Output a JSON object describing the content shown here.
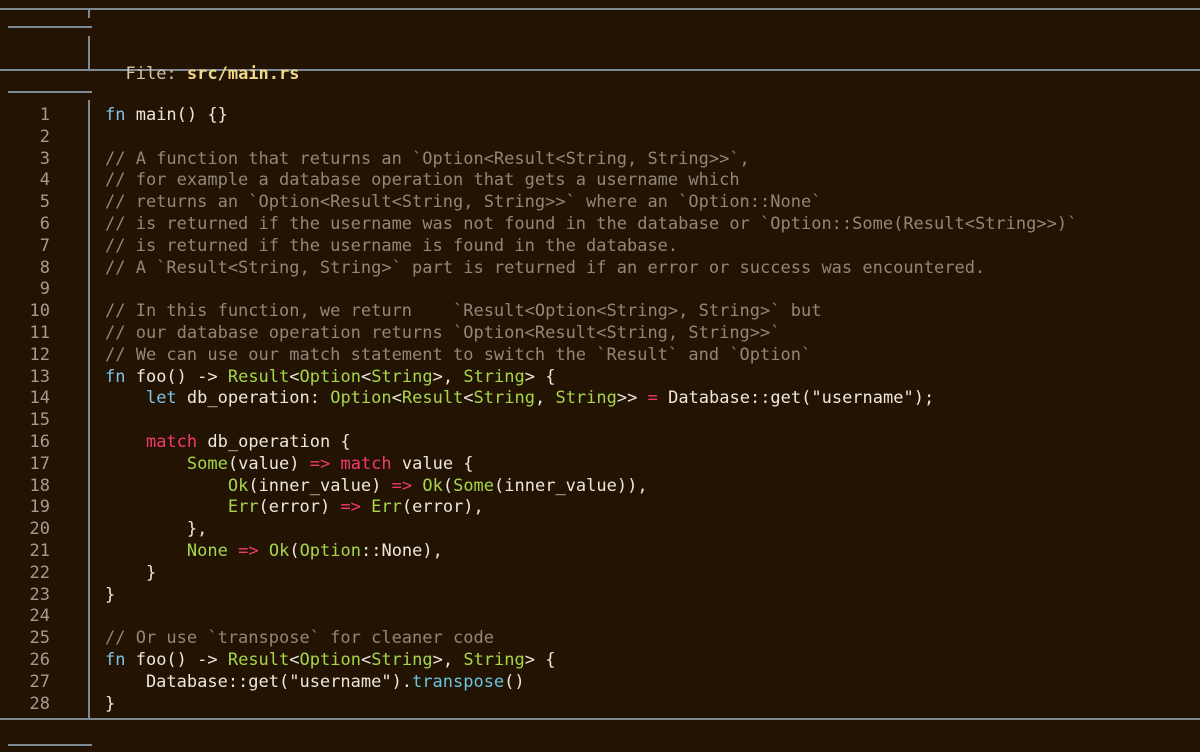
{
  "colors": {
    "background": "#231303",
    "rule": "#7d8a93",
    "keyword": "#7fc3e8",
    "type": "#a6d64a",
    "control": "#f23a6e",
    "comment": "#918779",
    "text": "#ece7dc",
    "line_number": "#a59b8e",
    "file_name": "#f0d68a"
  },
  "header": {
    "label": "File: ",
    "filename": "src/main.rs"
  },
  "code": {
    "lines": [
      [
        {
          "t": "fn",
          "c": "kw"
        },
        {
          "t": " main() {}",
          "c": "plain"
        }
      ],
      [],
      [
        {
          "t": "// A function that returns an `Option<Result<String, String>>`,",
          "c": "comment"
        }
      ],
      [
        {
          "t": "// for example a database operation that gets a username which",
          "c": "comment"
        }
      ],
      [
        {
          "t": "// returns an `Option<Result<String, String>>` where an `Option::None`",
          "c": "comment"
        }
      ],
      [
        {
          "t": "// is returned if the username was not found in the database or `Option::Some(Result<String>>)`",
          "c": "comment"
        }
      ],
      [
        {
          "t": "// is returned if the username is found in the database.",
          "c": "comment"
        }
      ],
      [
        {
          "t": "// A `Result<String, String>` part is returned if an error or success was encountered.",
          "c": "comment"
        }
      ],
      [],
      [
        {
          "t": "// In this function, we return    `Result<Option<String>, String>` but",
          "c": "comment"
        }
      ],
      [
        {
          "t": "// our database operation returns `Option<Result<String, String>>`",
          "c": "comment"
        }
      ],
      [
        {
          "t": "// We can use our match statement to switch the `Result` and `Option`",
          "c": "comment"
        }
      ],
      [
        {
          "t": "fn",
          "c": "kw"
        },
        {
          "t": " foo() -> ",
          "c": "plain"
        },
        {
          "t": "Result",
          "c": "type"
        },
        {
          "t": "<",
          "c": "plain"
        },
        {
          "t": "Option",
          "c": "type"
        },
        {
          "t": "<",
          "c": "plain"
        },
        {
          "t": "String",
          "c": "type"
        },
        {
          "t": ">, ",
          "c": "plain"
        },
        {
          "t": "String",
          "c": "type"
        },
        {
          "t": "> {",
          "c": "plain"
        }
      ],
      [
        {
          "t": "    ",
          "c": "plain"
        },
        {
          "t": "let",
          "c": "kw"
        },
        {
          "t": " db_operation: ",
          "c": "plain"
        },
        {
          "t": "Option",
          "c": "type"
        },
        {
          "t": "<",
          "c": "plain"
        },
        {
          "t": "Result",
          "c": "type"
        },
        {
          "t": "<",
          "c": "plain"
        },
        {
          "t": "String",
          "c": "type"
        },
        {
          "t": ", ",
          "c": "plain"
        },
        {
          "t": "String",
          "c": "type"
        },
        {
          "t": ">> ",
          "c": "plain"
        },
        {
          "t": "=",
          "c": "ctrl"
        },
        {
          "t": " Database::get(\"username\");",
          "c": "plain"
        }
      ],
      [],
      [
        {
          "t": "    ",
          "c": "plain"
        },
        {
          "t": "match",
          "c": "ctrl"
        },
        {
          "t": " db_operation {",
          "c": "plain"
        }
      ],
      [
        {
          "t": "        ",
          "c": "plain"
        },
        {
          "t": "Some",
          "c": "type"
        },
        {
          "t": "(value) ",
          "c": "plain"
        },
        {
          "t": "=>",
          "c": "ctrl"
        },
        {
          "t": " ",
          "c": "plain"
        },
        {
          "t": "match",
          "c": "ctrl"
        },
        {
          "t": " value {",
          "c": "plain"
        }
      ],
      [
        {
          "t": "            ",
          "c": "plain"
        },
        {
          "t": "Ok",
          "c": "type"
        },
        {
          "t": "(inner_value) ",
          "c": "plain"
        },
        {
          "t": "=>",
          "c": "ctrl"
        },
        {
          "t": " ",
          "c": "plain"
        },
        {
          "t": "Ok",
          "c": "type"
        },
        {
          "t": "(",
          "c": "plain"
        },
        {
          "t": "Some",
          "c": "type"
        },
        {
          "t": "(inner_value)),",
          "c": "plain"
        }
      ],
      [
        {
          "t": "            ",
          "c": "plain"
        },
        {
          "t": "Err",
          "c": "type"
        },
        {
          "t": "(error) ",
          "c": "plain"
        },
        {
          "t": "=>",
          "c": "ctrl"
        },
        {
          "t": " ",
          "c": "plain"
        },
        {
          "t": "Err",
          "c": "type"
        },
        {
          "t": "(error),",
          "c": "plain"
        }
      ],
      [
        {
          "t": "        },",
          "c": "plain"
        }
      ],
      [
        {
          "t": "        ",
          "c": "plain"
        },
        {
          "t": "None",
          "c": "type"
        },
        {
          "t": " ",
          "c": "plain"
        },
        {
          "t": "=>",
          "c": "ctrl"
        },
        {
          "t": " ",
          "c": "plain"
        },
        {
          "t": "Ok",
          "c": "type"
        },
        {
          "t": "(",
          "c": "plain"
        },
        {
          "t": "Option",
          "c": "type"
        },
        {
          "t": "::None),",
          "c": "plain"
        }
      ],
      [
        {
          "t": "    }",
          "c": "plain"
        }
      ],
      [
        {
          "t": "}",
          "c": "plain"
        }
      ],
      [],
      [
        {
          "t": "// Or use `transpose` for cleaner code",
          "c": "comment"
        }
      ],
      [
        {
          "t": "fn",
          "c": "kw"
        },
        {
          "t": " foo() -> ",
          "c": "plain"
        },
        {
          "t": "Result",
          "c": "type"
        },
        {
          "t": "<",
          "c": "plain"
        },
        {
          "t": "Option",
          "c": "type"
        },
        {
          "t": "<",
          "c": "plain"
        },
        {
          "t": "String",
          "c": "type"
        },
        {
          "t": ">, ",
          "c": "plain"
        },
        {
          "t": "String",
          "c": "type"
        },
        {
          "t": "> {",
          "c": "plain"
        }
      ],
      [
        {
          "t": "    Database::get(\"username\").",
          "c": "plain"
        },
        {
          "t": "transpose",
          "c": "method"
        },
        {
          "t": "()",
          "c": "plain"
        }
      ],
      [
        {
          "t": "}",
          "c": "plain"
        }
      ]
    ]
  }
}
